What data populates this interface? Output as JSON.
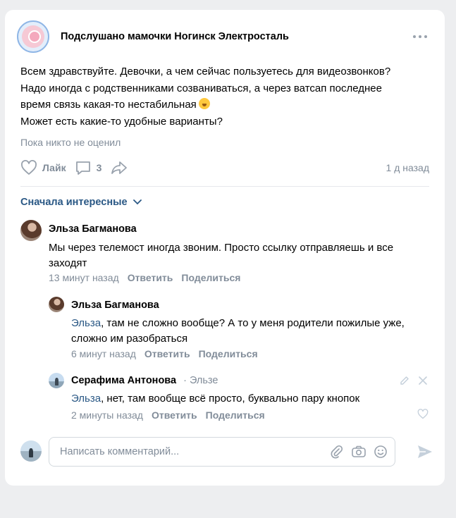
{
  "post": {
    "group_name": "Подслушано мамочки Ногинск Электросталь",
    "text_lines": [
      "Всем здравствуйте. Девочки, а чем сейчас пользуетесь для видеозвонков?",
      "Надо иногда с родственниками созваниваться, а через ватсап последнее",
      "время связь какая-то нестабильная",
      "Может есть какие-то удобные варианты?"
    ],
    "no_likes": "Пока никто не оценил",
    "like_label": "Лайк",
    "comments_count": "3",
    "time_ago": "1 д назад"
  },
  "sort_label": "Сначала интересные",
  "comments": [
    {
      "author": "Эльза Багманова",
      "text_lines": [
        "Мы через телемост иногда звоним. Просто ссылку отправляешь и все",
        "заходят"
      ],
      "time": "13 минут назад",
      "reply_label": "Ответить",
      "share_label": "Поделиться"
    },
    {
      "author": "Эльза Багманова",
      "mention": "Эльза",
      "text_line1_rest": ", там не сложно вообще? А то у меня родители пожилые уже,",
      "text_line2": "сложно им разобраться",
      "time": "6 минут назад",
      "reply_label": "Ответить",
      "share_label": "Поделиться"
    },
    {
      "author": "Серафима Антонова",
      "reply_to": "· Эльзе",
      "mention": "Эльза",
      "text_rest": ", нет, там вообще всё просто, буквально пару кнопок",
      "time": "2 минуты назад",
      "reply_label": "Ответить",
      "share_label": "Поделиться"
    }
  ],
  "comment_input": {
    "placeholder": "Написать комментарий..."
  },
  "colors": {
    "accent": "#2a5885",
    "secondary_text": "#818c99",
    "background": "#edeef0"
  },
  "icons": [
    "more-icon",
    "heart-icon",
    "comment-icon",
    "share-icon",
    "chevron-down-icon",
    "edit-icon",
    "close-icon",
    "attach-icon",
    "camera-icon",
    "emoji-icon",
    "send-icon"
  ]
}
